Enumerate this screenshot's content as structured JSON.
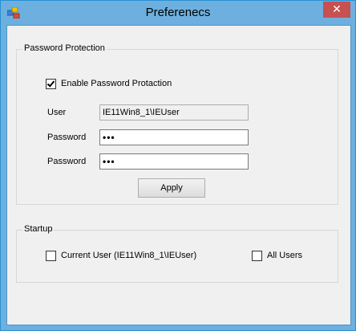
{
  "window": {
    "title": "Preferenecs"
  },
  "password_protection": {
    "legend": "Password Protection",
    "enable_label": "Enable Password Protaction",
    "enable_checked": true,
    "user_label": "User",
    "user_value": "IE11Win8_1\\IEUser",
    "password_label": "Password",
    "password_value": "•••",
    "confirm_label": "Password",
    "confirm_value": "•••",
    "apply_label": "Apply"
  },
  "startup": {
    "legend": "Startup",
    "current_user_label": "Current User (IE11Win8_1\\IEUser)",
    "current_user_checked": false,
    "all_users_label": "All Users",
    "all_users_checked": false
  }
}
